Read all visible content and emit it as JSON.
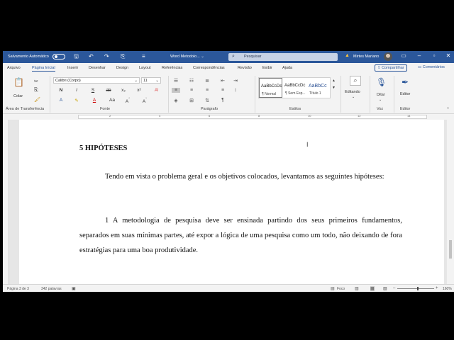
{
  "titlebar": {
    "autosave_label": "Salvamento Automático",
    "doc_title": "Word Metodolo... ⌄",
    "search_placeholder": "Pesquisar",
    "user_name": "Mirtes Mariano",
    "icons": {
      "save": "save-icon",
      "undo": "undo-icon",
      "redo": "redo-icon",
      "customize": "customize-icon",
      "search": "search-icon",
      "warning": "warning-icon"
    }
  },
  "tabs": [
    "Arquivo",
    "Página Inicial",
    "Inserir",
    "Desenhar",
    "Design",
    "Layout",
    "Referências",
    "Correspondências",
    "Revisão",
    "Exibir",
    "Ajuda"
  ],
  "active_tab": "Página Inicial",
  "share_label": "Compartilhar",
  "comments_label": "Comentários",
  "ribbon": {
    "clipboard": {
      "paste_label": "Colar",
      "group_label": "Área de Transferência"
    },
    "font": {
      "font_name": "Calibri (Corpo)",
      "font_size": "11",
      "group_label": "Fonte"
    },
    "paragraph": {
      "group_label": "Parágrafo"
    },
    "styles": {
      "group_label": "Estilos",
      "items": [
        {
          "preview": "AaBbCcDc",
          "name": "¶ Normal"
        },
        {
          "preview": "AaBbCcDc",
          "name": "¶ Sem Esp..."
        },
        {
          "preview": "AaBbCc",
          "name": "Título 1"
        }
      ]
    },
    "editing": {
      "label": "Editando"
    },
    "voice": {
      "label": "Ditar",
      "group_label": "Voz"
    },
    "editor": {
      "label": "Editor",
      "group_label": "Editor"
    }
  },
  "document": {
    "heading": "5 HIPÓTESES",
    "paragraphs": [
      "Tendo em vista o problema geral e os objetivos colocados, levantamos as seguintes hipóteses:",
      "1 A metodologia de pesquisa deve ser ensinada partindo dos seus primeiros fundamentos, separados em suas mínimas partes, até expor a lógica de uma pesquisa como um todo, não deixando de fora estratégias para uma boa produtividade."
    ]
  },
  "status": {
    "page": "Página 3 de 3",
    "words": "342 palavras",
    "focus": "Foco",
    "zoom": "160%"
  }
}
